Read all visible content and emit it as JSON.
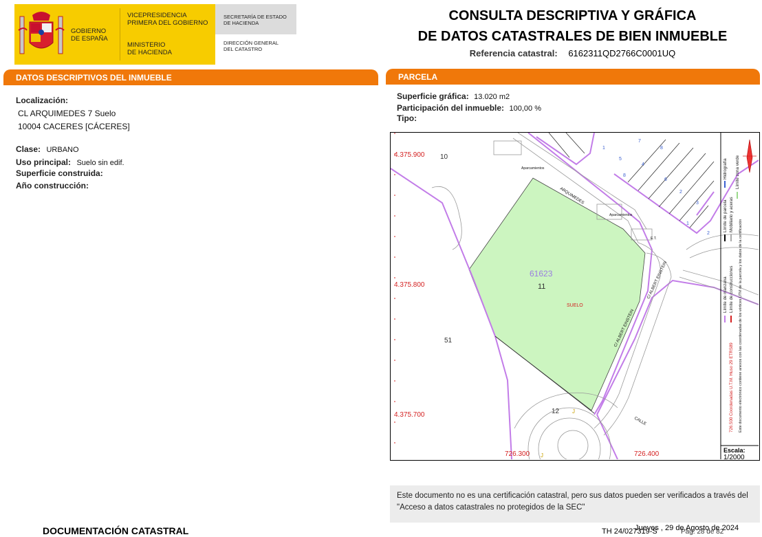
{
  "header": {
    "gobierno": [
      "GOBIERNO",
      "DE ESPAÑA"
    ],
    "vicepresidencia": [
      "VICEPRESIDENCIA",
      "PRIMERA DEL GOBIERNO"
    ],
    "ministerio": [
      "MINISTERIO",
      "DE HACIENDA"
    ],
    "secretaria": [
      "SECRETARÍA DE ESTADO",
      "DE HACIENDA"
    ],
    "direccion": [
      "DIRECCIÓN GENERAL",
      "DEL CATASTRO"
    ],
    "title_line1": "CONSULTA DESCRIPTIVA Y GRÁFICA",
    "title_line2": "DE DATOS CATASTRALES DE BIEN INMUEBLE",
    "ref_label": "Referencia catastral:",
    "ref_value": "6162311QD2766C0001UQ"
  },
  "datos": {
    "section_title": "DATOS DESCRIPTIVOS DEL INMUEBLE",
    "localizacion_label": "Localización:",
    "localizacion_line1": "CL ARQUIMEDES 7 Suelo",
    "localizacion_line2": "10004 CACERES [CÁCERES]",
    "clase_label": "Clase:",
    "clase_value": "URBANO",
    "uso_label": "Uso principal:",
    "uso_value": "Suelo sin edif.",
    "superficie_construida_label": "Superficie construida:",
    "anio_label": "Año construcción:"
  },
  "parcela": {
    "section_title": "PARCELA",
    "superficie_label": "Superficie gráfica:",
    "superficie_value": "13.020 m2",
    "participacion_label": "Participación del inmueble:",
    "participacion_value": "100,00 %",
    "tipo_label": "Tipo:"
  },
  "map": {
    "y_labels": [
      "4.375.900",
      "4.375.800",
      "4.375.700"
    ],
    "x_labels": [
      "726.300",
      "726.400"
    ],
    "parcel_ref": "61623",
    "parcel_num": "11",
    "suelo": "SUELO",
    "neighbors": [
      "10",
      "51",
      "12"
    ],
    "street_arquimedes": "ARQUIMEDES",
    "street_einstein": "C/ ALBERT EINSTEIN",
    "street_calle": "CALLE",
    "aparcamientos": "Aparcamientos",
    "et": "E.T.",
    "j_mark": "J",
    "escala_label": "Escala:",
    "escala_value": "1/2000",
    "legend_items": [
      "Límite de manzana",
      "Límite de parcela",
      "Límite de construcciones",
      "Mobiliario y aceras",
      "Límite zona verde",
      "Hidrografía"
    ],
    "legend_coords": "726.500 Coordenadas U.T.M. Huso 29 ETRS89",
    "legend_note": "Este documento electrónico contiene anexos con las coordenadas de los vértices UTM de la parcela y los datos de la certificación",
    "colors": {
      "parcel_fill": "#ccf5c0",
      "manzana": "#c27ce8",
      "axis_red": "#d42020",
      "streets_blue": "#3a5fd0"
    }
  },
  "note_text": "Este documento no es una certificación catastral, pero sus datos pueden ser verificados a través del \"Acceso a datos catastrales no protegidos de la SEC\"",
  "footer": {
    "doc_title": "DOCUMENTACIÓN CATASTRAL",
    "th": "TH 24/027319-S",
    "date": "Jueves , 29 de Agosto de 2024",
    "page": "Pág. 28 de 82"
  }
}
